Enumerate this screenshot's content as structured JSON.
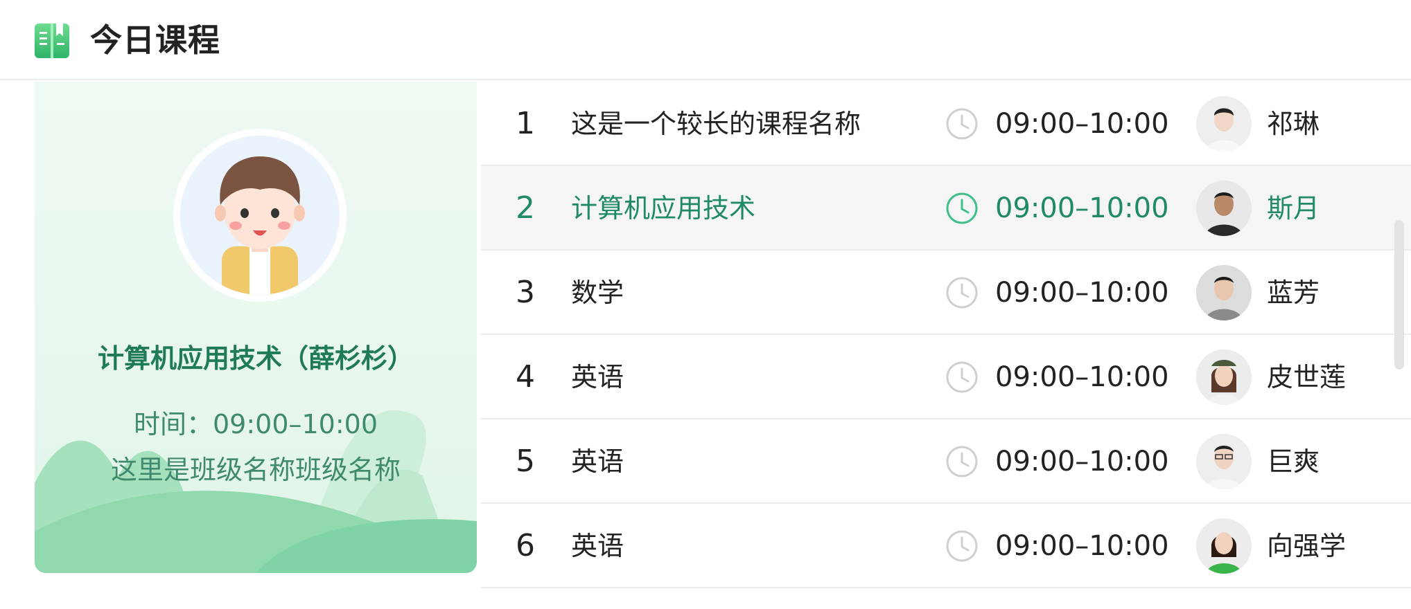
{
  "header": {
    "title": "今日课程",
    "logo_icon": "book-icon"
  },
  "current": {
    "course_name": "计算机应用技术（薛杉杉）",
    "time_label": "时间：09:00–10:00",
    "class_name": "这里是班级名称班级名称",
    "avatar_icon": "student-avatar"
  },
  "colors": {
    "accent": "#1f8a63",
    "accent_light": "#3fbf8a",
    "card_bg": "#eef9f1"
  },
  "schedule": [
    {
      "num": "1",
      "name": "这是一个较长的课程名称",
      "time": "09:00–10:00",
      "teacher": "祁琳",
      "active": false
    },
    {
      "num": "2",
      "name": "计算机应用技术",
      "time": "09:00–10:00",
      "teacher": "斯月",
      "active": true
    },
    {
      "num": "3",
      "name": "数学",
      "time": "09:00–10:00",
      "teacher": "蓝芳",
      "active": false
    },
    {
      "num": "4",
      "name": "英语",
      "time": "09:00–10:00",
      "teacher": "皮世莲",
      "active": false
    },
    {
      "num": "5",
      "name": "英语",
      "time": "09:00–10:00",
      "teacher": "巨爽",
      "active": false
    },
    {
      "num": "6",
      "name": "英语",
      "time": "09:00–10:00",
      "teacher": "向强学",
      "active": false
    }
  ]
}
